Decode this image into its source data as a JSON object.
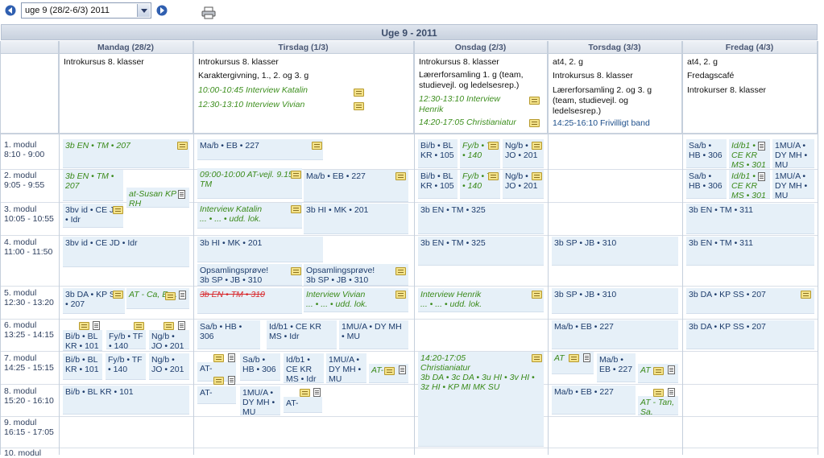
{
  "toolbar": {
    "week_select_value": "uge 9 (28/2-6/3) 2011",
    "prev_icon": "arrow-left-icon",
    "next_icon": "arrow-right-icon",
    "print_icon": "printer-icon"
  },
  "calendar": {
    "title": "Uge 9 - 2011",
    "days": [
      "Mandag (28/2)",
      "Tirsdag (1/3)",
      "Onsdag (2/3)",
      "Torsdag (3/3)",
      "Fredag (4/3)"
    ],
    "modules": [
      {
        "name": "1. modul",
        "time": "8:10 - 9:00"
      },
      {
        "name": "2. modul",
        "time": "9:05 - 9:55"
      },
      {
        "name": "3. modul",
        "time": "10:05 - 10:55"
      },
      {
        "name": "4. modul",
        "time": "11:00 - 11:50"
      },
      {
        "name": "5. modul",
        "time": "12:30 - 13:20"
      },
      {
        "name": "6. modul",
        "time": "13:25 - 14:15"
      },
      {
        "name": "7. modul",
        "time": "14:25 - 15:15"
      },
      {
        "name": "8. modul",
        "time": "15:20 - 16:10"
      },
      {
        "name": "9. modul",
        "time": "16:15 - 17:05"
      },
      {
        "name": "10. modul",
        "time": ""
      }
    ],
    "allday": {
      "mon": [
        "Introkursus 8. klasser"
      ],
      "tue": [
        "Introkursus 8. klasser",
        "Karaktergivning, 1., 2. og 3. g",
        "10:00-10:45 Interview Katalin",
        "12:30-13:10 Interview Vivian"
      ],
      "wed": [
        "Introkursus 8. klasser",
        "Lærerforsamling 1. g (team, studievejl. og ledelsesrep.)",
        "12:30-13:10 Interview Henrik",
        "14:20-17:05 Christianiatur"
      ],
      "thu": [
        "at4, 2. g",
        "Introkursus 8. klasser",
        "Lærerforsamling 2. og 3. g (team, studievejl. og ledelsesrep.)",
        "14:25-16:10 Frivilligt band"
      ],
      "fri": [
        "at4, 2. g",
        "Fredagscafé",
        "Introkurser 8. klasser"
      ]
    },
    "events": {
      "mon": [
        "3b EN • TM • 207",
        "3b EN • TM • 207",
        "at-Susan KP RH",
        "3bv id • CE JD • Idr",
        "3bv id • CE JD • Idr",
        "3b DA • KP SS • 207",
        "AT - Ca, Em.",
        "Bi/b • BL KR • 101",
        "Fy/b • TF • 140",
        "Ng/b • JO • 201",
        "Bi/b • BL KR • 101",
        "Fy/b • TF • 140",
        "Ng/b • JO • 201",
        "Bi/b • BL KR • 101"
      ],
      "tue": [
        "Ma/b • EB • 227",
        "09:00-10:00 AT-vejl. 9.15 TM",
        "Ma/b • EB • 227",
        "Interview Katalin",
        "... • ... • udd. lok.",
        "3b HI • MK • 201",
        "3b HI • MK • 201",
        "Opsamlingsprøve!",
        "3b SP • JB • 310",
        "Opsamlingsprøve!",
        "3b SP • JB • 310",
        "3b EN • TM • 310",
        "Interview Vivian",
        "... • ... • udd. lok.",
        "Sa/b • HB • 306",
        "Id/b1 • CE KR MS • Idr",
        "1MU/A • DY MH • MU",
        "AT-",
        "Sa/b • HB • 306",
        "Id/b1 • CE KR MS • Idr",
        "1MU/A • DY MH • MU",
        "AT-",
        "AT-",
        "1MU/A • DY MH • MU",
        "AT-"
      ],
      "wed": [
        "Bi/b • BL KR • 105",
        "Fy/b • TF • 140",
        "Ng/b • JO • 201",
        "Bi/b • BL KR • 105",
        "Fy/b • TF • 140",
        "Ng/b • JO • 201",
        "3b EN • TM • 325",
        "3b EN • TM • 325",
        "Interview Henrik",
        "... • ... • udd. lok.",
        "14:20-17:05",
        "Christianiatur",
        "3b DA • 3c DA • 3u HI • 3v HI • 3z HI • KP MI MK SU"
      ],
      "thu": [
        "3b SP • JB • 310",
        "3b SP • JB • 310",
        "Ma/b • EB • 227",
        "AT",
        "Ma/b • EB • 227",
        "AT",
        "Ma/b • EB • 227",
        "AT - Tan, Sa."
      ],
      "fri": [
        "Sa/b • HB • 306",
        "Id/b1 • CE KR MS • 301",
        "1MU/A • DY MH • MU",
        "Sa/b • HB • 306",
        "Id/b1 • CE KR MS • 301",
        "1MU/A • DY MH • MU",
        "3b EN • TM • 311",
        "3b EN • TM • 311",
        "3b DA • KP SS • 207",
        "3b DA • KP SS • 207"
      ]
    }
  }
}
